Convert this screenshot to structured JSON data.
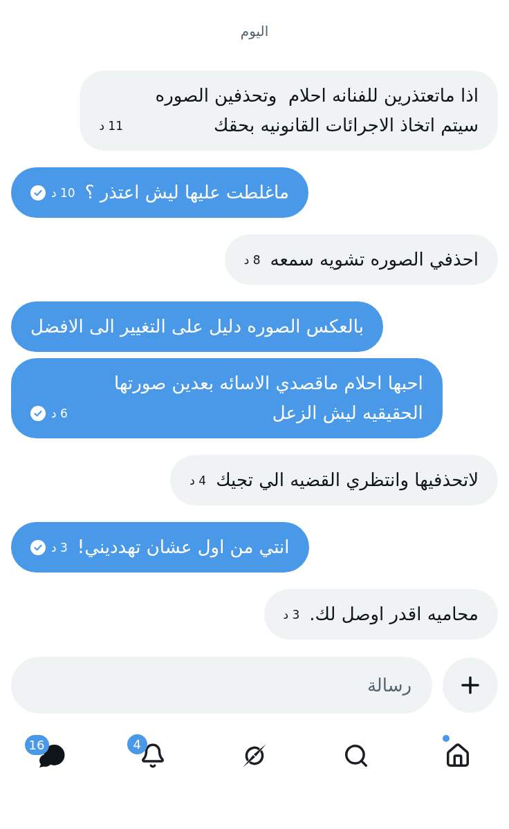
{
  "date_divider": "اليوم",
  "messages": [
    {
      "kind": "received",
      "text": "اذا ماتعتذرين للفنانه احلام  وتحذفين الصوره سيتم اتخاذ الاجرائات القانونيه بحقك",
      "time": "11 د",
      "seen": false
    },
    {
      "kind": "sent",
      "text": "ماغلطت عليها ليش اعتذر ؟",
      "time": "10 د",
      "seen": true
    },
    {
      "kind": "received",
      "text": "احذفي الصوره تشويه سمعه",
      "time": "8 د",
      "seen": false
    },
    {
      "kind": "sent",
      "text": "بالعكس الصوره دليل على التغيير الى الافضل",
      "seen": false
    },
    {
      "kind": "sent",
      "text": "احبها احلام ماقصدي الاسائه بعدين صورتها الحقيقيه ليش الزعل",
      "time": "6 د",
      "seen": true
    },
    {
      "kind": "received",
      "text": "لاتحذفيها وانتظري القضيه الي تجيك",
      "time": "4 د",
      "seen": false
    },
    {
      "kind": "sent",
      "text": "انتي من اول عشان تهدديني!",
      "time": "3 د",
      "seen": true
    },
    {
      "kind": "received",
      "text": "محاميه اقدر اوصل لك.",
      "time": "3 د",
      "seen": false
    }
  ],
  "composer": {
    "placeholder": "رسالة"
  },
  "nav": [
    {
      "kind": "home",
      "selected": false,
      "unread_dot": true
    },
    {
      "kind": "search",
      "selected": false,
      "unread_dot": false
    },
    {
      "kind": "slashed_circle",
      "selected": false,
      "unread_dot": false
    },
    {
      "kind": "notifications",
      "selected": false,
      "unread_dot": false,
      "badge": "4"
    },
    {
      "kind": "messages",
      "selected": true,
      "unread_dot": false,
      "badge": "16"
    }
  ]
}
